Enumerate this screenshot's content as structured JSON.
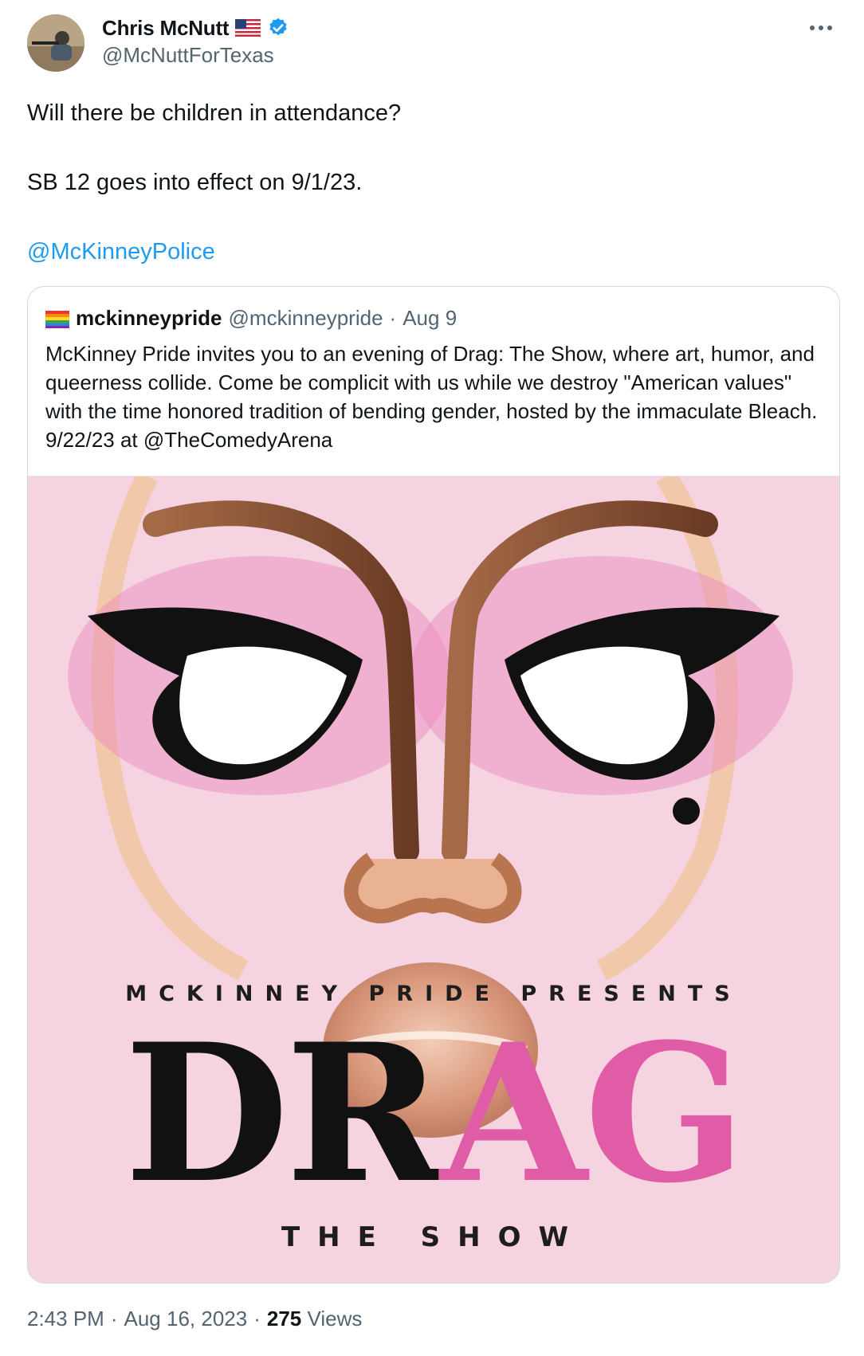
{
  "author": {
    "display_name": "Chris McNutt",
    "handle": "@McNuttForTexas",
    "flag_icon": "us-flag-icon",
    "verified_icon": "verified-badge-icon",
    "more_icon": "more-options-icon"
  },
  "tweet": {
    "line1": "Will there be children in attendance?",
    "line2": "SB 12 goes into effect on 9/1/23.",
    "mention": "@McKinneyPolice"
  },
  "quote": {
    "name": "mckinneypride",
    "handle": "@mckinneypride",
    "separator": "·",
    "date": "Aug 9",
    "text": "McKinney Pride invites you to an evening of Drag: The Show, where art, humor, and queerness collide. Come be complicit with us while we destroy \"American values\" with the time honored tradition of bending gender, hosted by the immaculate Bleach. 9/22/23 at @TheComedyArena",
    "poster": {
      "line1": "MCKINNEY PRIDE PRESENTS",
      "title_part1": "DR",
      "title_part2": "AG",
      "line2": "THE SHOW"
    }
  },
  "meta": {
    "time": "2:43 PM",
    "sep1": "·",
    "date": "Aug 16, 2023",
    "sep2": "·",
    "views_count": "275",
    "views_label": "Views"
  },
  "colors": {
    "link": "#1d9bf0",
    "secondary_text": "#536471",
    "verified": "#1d9bf0",
    "poster_bg": "#f5d3e0",
    "poster_pink": "#e15ca6"
  }
}
